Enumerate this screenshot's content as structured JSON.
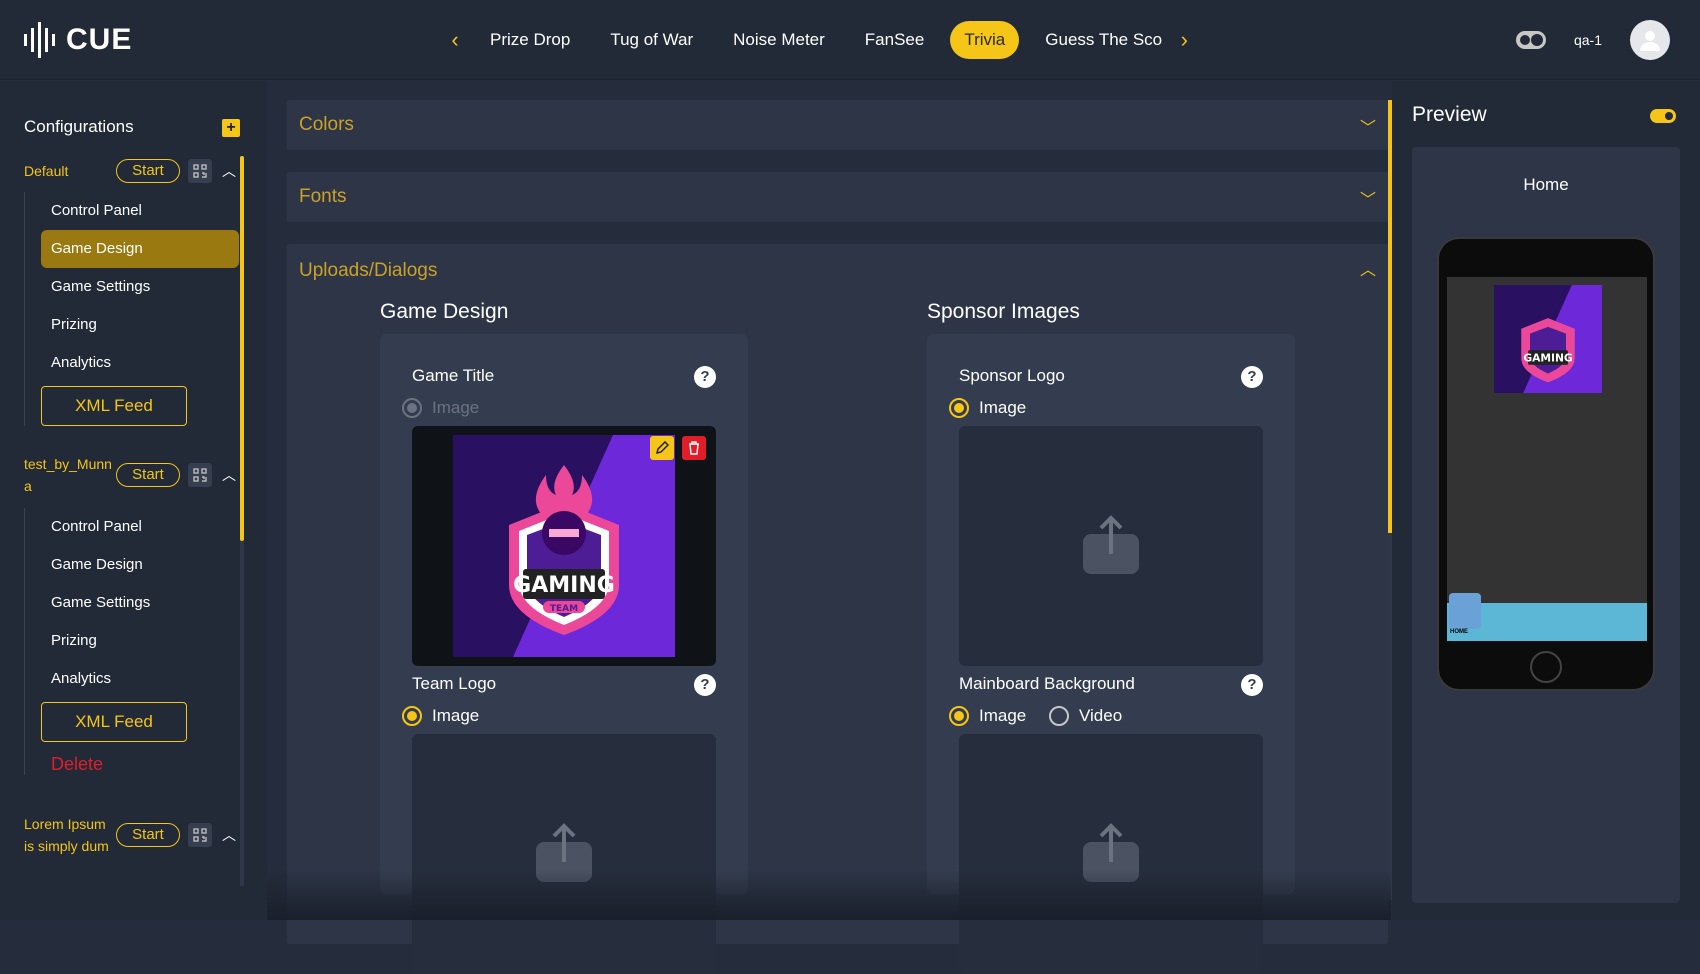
{
  "app": {
    "logo_text": "CUE"
  },
  "nav": {
    "tabs": [
      "Prize Drop",
      "Tug of War",
      "Noise Meter",
      "FanSee",
      "Trivia",
      "Guess The Sco"
    ],
    "active_tab": "Trivia"
  },
  "user": {
    "name": "qa-1"
  },
  "sidebar": {
    "title": "Configurations",
    "configs": [
      {
        "name": "Default",
        "start_label": "Start",
        "items": [
          "Control Panel",
          "Game Design",
          "Game Settings",
          "Prizing",
          "Analytics"
        ],
        "active_item": "Game Design",
        "xml_label": "XML Feed"
      },
      {
        "name": "test_by_Munna",
        "start_label": "Start",
        "items": [
          "Control Panel",
          "Game Design",
          "Game Settings",
          "Prizing",
          "Analytics"
        ],
        "xml_label": "XML Feed",
        "delete_label": "Delete"
      },
      {
        "name": "Lorem Ipsum is simply dum",
        "start_label": "Start"
      }
    ]
  },
  "main": {
    "sections": [
      {
        "title": "Colors",
        "expanded": false
      },
      {
        "title": "Fonts",
        "expanded": false
      },
      {
        "title": "Uploads/Dialogs",
        "expanded": true
      }
    ],
    "game_design": {
      "title": "Game Design",
      "game_title": {
        "label": "Game Title",
        "option": "Image"
      },
      "team_logo": {
        "label": "Team Logo",
        "option": "Image"
      }
    },
    "sponsor_images": {
      "title": "Sponsor Images",
      "sponsor_logo": {
        "label": "Sponsor Logo",
        "option": "Image"
      },
      "mainboard_background": {
        "label": "Mainboard Background",
        "option_image": "Image",
        "option_video": "Video"
      }
    }
  },
  "preview": {
    "title": "Preview",
    "screen_title": "Home",
    "phone_button": "HOME"
  },
  "colors": {
    "accent": "#f5c518",
    "danger": "#e11d2a",
    "bg": "#252c3b"
  }
}
